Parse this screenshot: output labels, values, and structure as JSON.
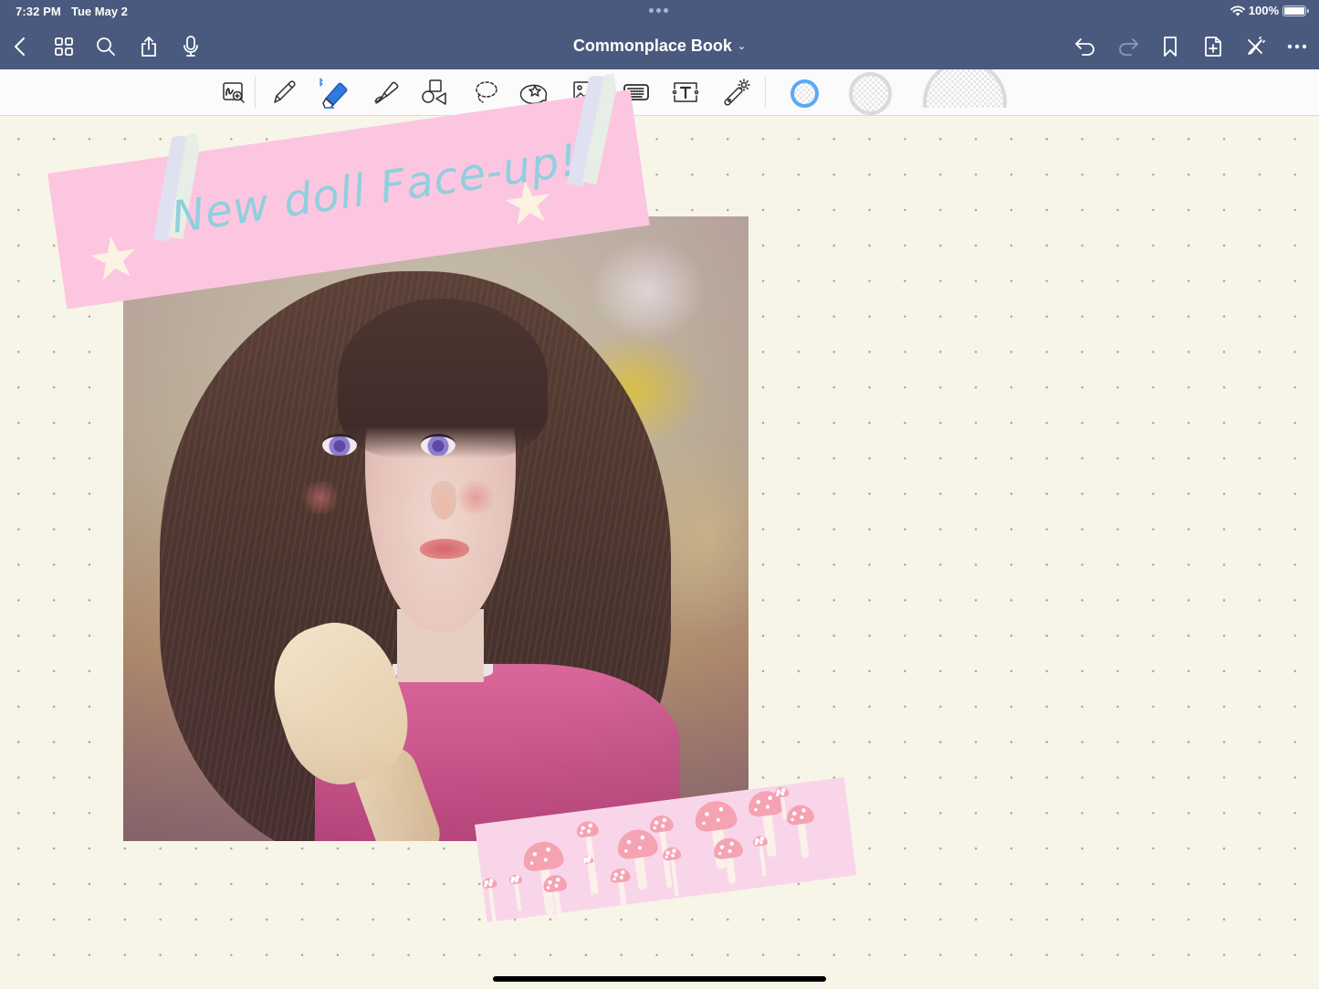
{
  "status_bar": {
    "time": "7:32 PM",
    "date": "Tue May 2",
    "battery_text": "100%",
    "battery_level": 1.0,
    "wifi_icon": "wifi-icon",
    "multitask_icon": "more-dots-icon"
  },
  "nav_bar": {
    "title": "Commonplace Book",
    "title_chevron": "⌄",
    "left_buttons": [
      {
        "name": "back-button",
        "icon": "chevron-left-icon"
      },
      {
        "name": "thumbnails-button",
        "icon": "grid-icon"
      },
      {
        "name": "search-button",
        "icon": "search-icon"
      },
      {
        "name": "share-button",
        "icon": "share-icon"
      },
      {
        "name": "record-audio-button",
        "icon": "microphone-icon"
      }
    ],
    "right_buttons": [
      {
        "name": "undo-button",
        "icon": "undo-icon",
        "enabled": true
      },
      {
        "name": "redo-button",
        "icon": "redo-icon",
        "enabled": false
      },
      {
        "name": "bookmark-button",
        "icon": "bookmark-icon"
      },
      {
        "name": "add-page-button",
        "icon": "add-page-icon"
      },
      {
        "name": "pen-toggle-button",
        "icon": "pencil-off-icon"
      },
      {
        "name": "more-button",
        "icon": "ellipsis-icon"
      }
    ]
  },
  "toolbar": {
    "tools": [
      {
        "name": "zoom-window-tool",
        "icon": "handwriting-zoom-icon",
        "selected": false
      },
      {
        "name": "pen-tool",
        "icon": "pen-icon",
        "selected": false
      },
      {
        "name": "eraser-tool",
        "icon": "eraser-icon",
        "selected": true,
        "badge": "bluetooth-icon"
      },
      {
        "name": "highlighter-tool",
        "icon": "highlighter-icon",
        "selected": false
      },
      {
        "name": "shapes-tool",
        "icon": "shapes-icon",
        "selected": false
      },
      {
        "name": "lasso-tool",
        "icon": "lasso-icon",
        "selected": false
      },
      {
        "name": "elements-tool",
        "icon": "sticker-icon",
        "selected": false
      },
      {
        "name": "image-tool",
        "icon": "image-icon",
        "selected": false
      },
      {
        "name": "keyboard-tool",
        "icon": "keyboard-icon",
        "selected": false
      },
      {
        "name": "text-tool",
        "icon": "text-box-icon",
        "selected": false
      },
      {
        "name": "laser-pointer-tool",
        "icon": "laser-pointer-icon",
        "selected": false
      }
    ],
    "eraser_sizes": [
      {
        "name": "eraser-size-small",
        "selected": true
      },
      {
        "name": "eraser-size-medium",
        "selected": false
      },
      {
        "name": "eraser-size-large",
        "selected": false
      }
    ],
    "accent_color": "#5aa9f5"
  },
  "page": {
    "background": "dot-grid",
    "paper_color": "#f7f5e8",
    "title_sticker_text": "New doll Face-up!",
    "title_sticker_color": "#fcc6e1",
    "title_text_color": "#8fd0dd",
    "photo_description": "Ball-jointed doll with long brown hair, violet eyes and pink sweater",
    "bottom_sticker": "pink mushroom washi tape",
    "bottom_sticker_color": "#f9d5ea"
  }
}
